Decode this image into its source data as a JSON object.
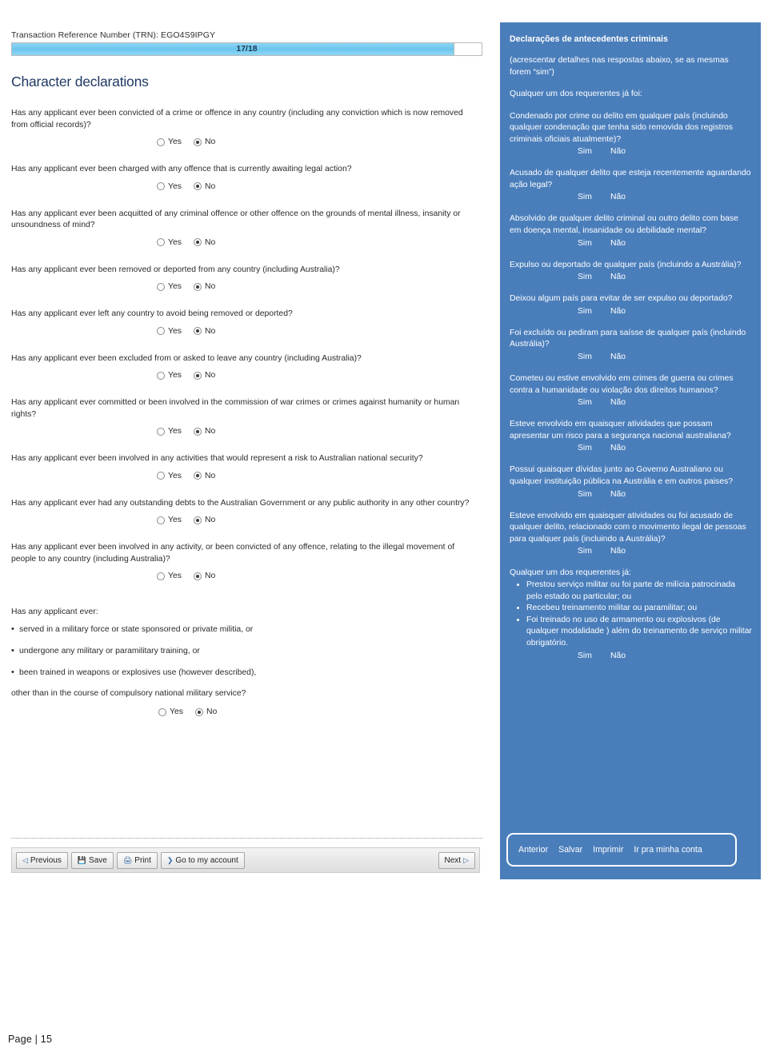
{
  "form": {
    "trn_label": "Transaction Reference Number (TRN): EGO4S9IPGY",
    "progress": {
      "label": "17/18",
      "percent": 94
    },
    "heading": "Character declarations",
    "questions": [
      {
        "text": "Has any applicant ever been convicted of a crime or offence in any country (including any conviction which is now removed from official records)?",
        "yes": "Yes",
        "no": "No",
        "selected": "No"
      },
      {
        "text": "Has any applicant ever been charged with any offence that is currently awaiting legal action?",
        "yes": "Yes",
        "no": "No",
        "selected": "No"
      },
      {
        "text": "Has any applicant ever been acquitted of any criminal offence or other offence on the grounds of mental illness, insanity or unsoundness of mind?",
        "yes": "Yes",
        "no": "No",
        "selected": "No"
      },
      {
        "text": "Has any applicant ever been removed or deported from any country (including Australia)?",
        "yes": "Yes",
        "no": "No",
        "selected": "No"
      },
      {
        "text": "Has any applicant ever left any country to avoid being removed or deported?",
        "yes": "Yes",
        "no": "No",
        "selected": "No"
      },
      {
        "text": "Has any applicant ever been excluded from or asked to leave any country (including Australia)?",
        "yes": "Yes",
        "no": "No",
        "selected": "No"
      },
      {
        "text": "Has any applicant ever committed or been involved in the commission of war crimes or crimes against humanity or human rights?",
        "yes": "Yes",
        "no": "No",
        "selected": "No"
      },
      {
        "text": "Has any applicant ever been involved in any activities that would represent a risk to Australian national security?",
        "yes": "Yes",
        "no": "No",
        "selected": "No"
      },
      {
        "text": "Has any applicant ever had any outstanding debts to the Australian Government or any public authority in any other country?",
        "yes": "Yes",
        "no": "No",
        "selected": "No"
      },
      {
        "text": "Has any applicant ever been involved in any activity, or been convicted of any offence, relating to the illegal movement of people to any country (including Australia)?",
        "yes": "Yes",
        "no": "No",
        "selected": "No"
      }
    ],
    "military": {
      "intro": "Has any applicant ever:",
      "bullets": [
        "served in a military force or state sponsored or private militia, or",
        "undergone any military or paramilitary training, or",
        "been trained in weapons or explosives use (however described),"
      ],
      "closing": "other than in the course of compulsory national military service?",
      "yes": "Yes",
      "no": "No",
      "selected": "No"
    },
    "toolbar": {
      "previous": "Previous",
      "save": "Save",
      "print": "Print",
      "go_to_account": "Go to my account",
      "next": "Next"
    }
  },
  "translation": {
    "title": "Declarações de antecedentes criminais",
    "note": "(acrescentar detalhes nas respostas abaixo,  se as mesmas forem “sim”)",
    "lead": "Qualquer um dos requerentes já foi:",
    "yes": "Sim",
    "no": "Não",
    "questions": [
      "Condenado por crime ou delito em qualquer país (incluindo qualquer condenação que tenha sido removida dos registros criminais oficiais atualmente)?",
      "Acusado de qualquer delito que esteja recentemente aguardando ação legal?",
      "Absolvido de qualquer delito criminal ou outro delito com base em doença mental, insanidade ou debilidade mental?",
      "Expulso ou deportado de qualquer país (incluindo a Austrália)?",
      "Deixou algum país para evitar  de ser expulso ou deportado?",
      "Foi excluído ou pediram para saísse de qualquer  país (incluindo Austrália)?",
      "Cometeu ou estive envolvido em crimes de guerra ou crimes contra a humanidade ou violação dos direitos humanos?",
      "Esteve envolvido em quaisquer atividades que possam apresentar um risco para a segurança nacional australiana?",
      "Possui quaisquer dívidas junto ao Governo Australiano ou qualquer instituição pública na Austrália e em outros paises?",
      "Esteve envolvido em quaisquer atividades  ou foi acusado de qualquer delito, relacionado com o movimento ilegal de pessoas para qualquer país (incluindo a Austrália)?"
    ],
    "military_lead": "Qualquer um dos requerentes já:",
    "military_bullets": [
      "Prestou serviço militar ou foi parte de milícia patrocinada pelo estado ou particular; ou",
      "Recebeu treinamento militar ou paramilitar; ou",
      "Foi treinado no uso de armamento ou explosivos (de qualquer modalidade ) além do treinamento de  serviço militar obrigatório."
    ],
    "buttons": {
      "previous": "Anterior",
      "save": "Salvar",
      "print": "Imprimir",
      "go_to_account": "Ir pra minha conta"
    }
  },
  "footer": {
    "page_label": "Page | 15"
  }
}
